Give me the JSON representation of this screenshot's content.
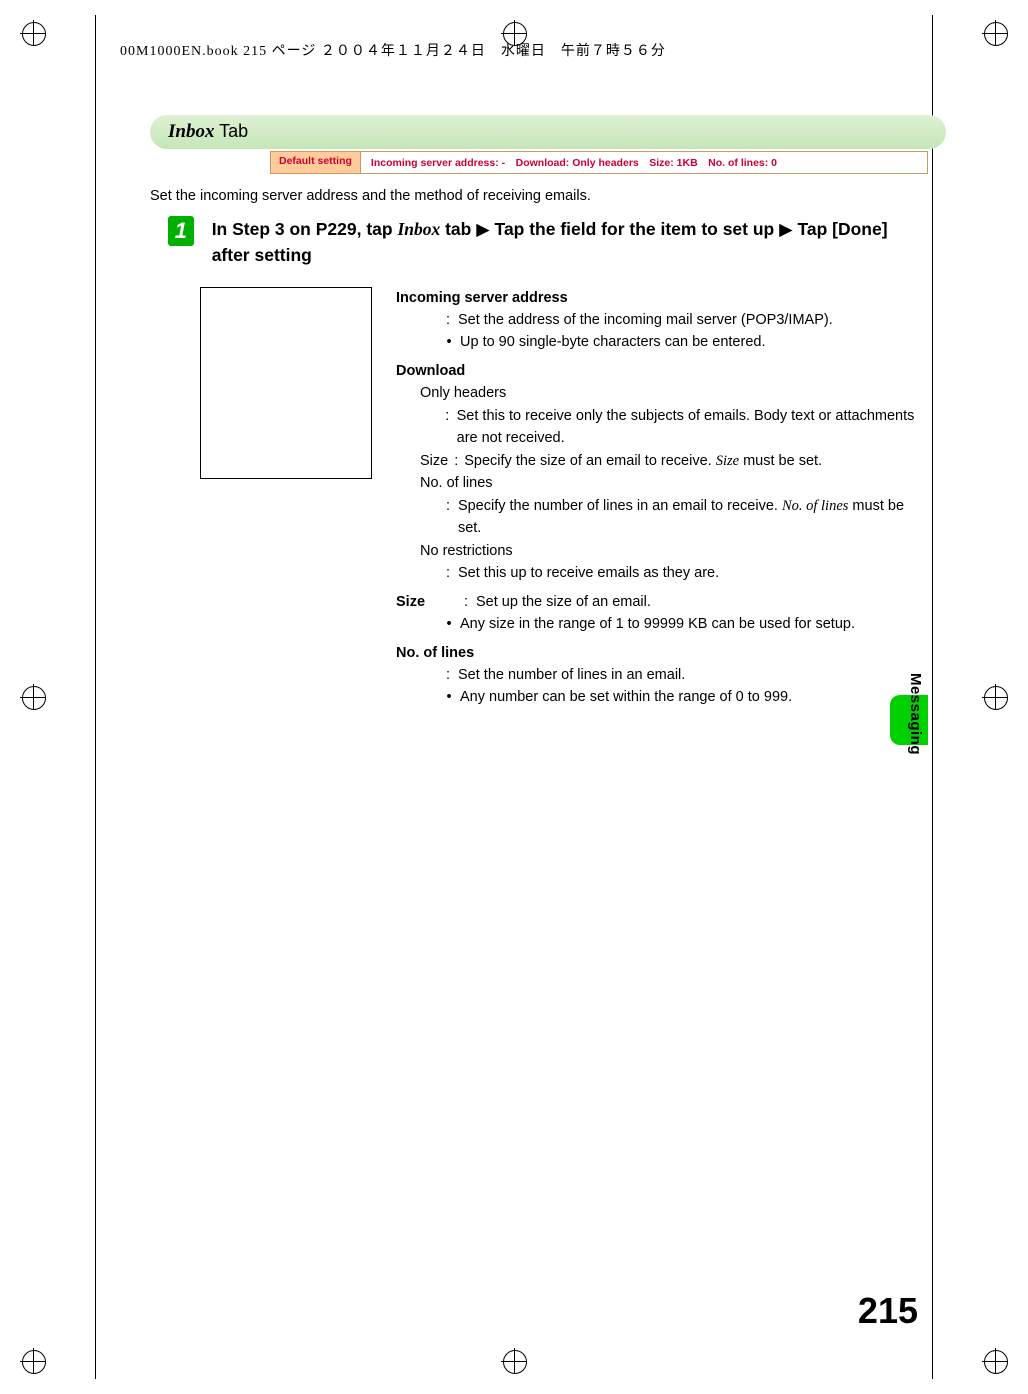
{
  "book_info": "00M1000EN.book  215 ページ  ２００４年１１月２４日　水曜日　午前７時５６分",
  "tab": {
    "title_italic": "Inbox",
    "title_rest": " Tab"
  },
  "defaults": {
    "label": "Default setting",
    "values": "Incoming server address: -　Download: Only headers　Size: 1KB　No. of lines: 0"
  },
  "intro": "Set the incoming server address and the method of receiving emails.",
  "step": {
    "number": "1",
    "pre": "In Step 3 on P229, tap ",
    "inbox": "Inbox",
    "mid": " tab ",
    "arrow1": "▶",
    "line1_rest": " Tap the field for the item to set up ",
    "arrow2": "▶",
    "after": " Tap [Done] after setting"
  },
  "details": {
    "incoming_header": "Incoming server address",
    "incoming_desc": "Set the address of the incoming mail server (POP3/IMAP).",
    "incoming_bullet": "Up to 90 single-byte characters can be entered.",
    "download_header": "Download",
    "only_headers_label": "Only headers",
    "only_headers_desc": "Set this to receive only the subjects of emails. Body text or attachments are not received.",
    "size_in_label": "Size",
    "size_in_desc_pre": "Specify the size of an email to receive. ",
    "size_italic": "Size",
    "size_in_desc_post": " must be set.",
    "nol_in_label": "No. of lines",
    "nol_in_desc_pre": "Specify the number of lines in an email to receive. ",
    "nol_italic": "No. of lines",
    "nol_in_desc_post": " must be set.",
    "nores_label": "No restrictions",
    "nores_desc": "Set this up to receive emails as they are.",
    "size_header": "Size",
    "size_desc": "Set up the size of an email.",
    "size_bullet": "Any size in the range of 1 to 99999 KB can be used for setup.",
    "nol_header": "No. of lines",
    "nol_desc": "Set the number of lines in an email.",
    "nol_bullet": "Any number can be set within the range of 0 to 999."
  },
  "side_label": "Messaging",
  "page_number": "215"
}
